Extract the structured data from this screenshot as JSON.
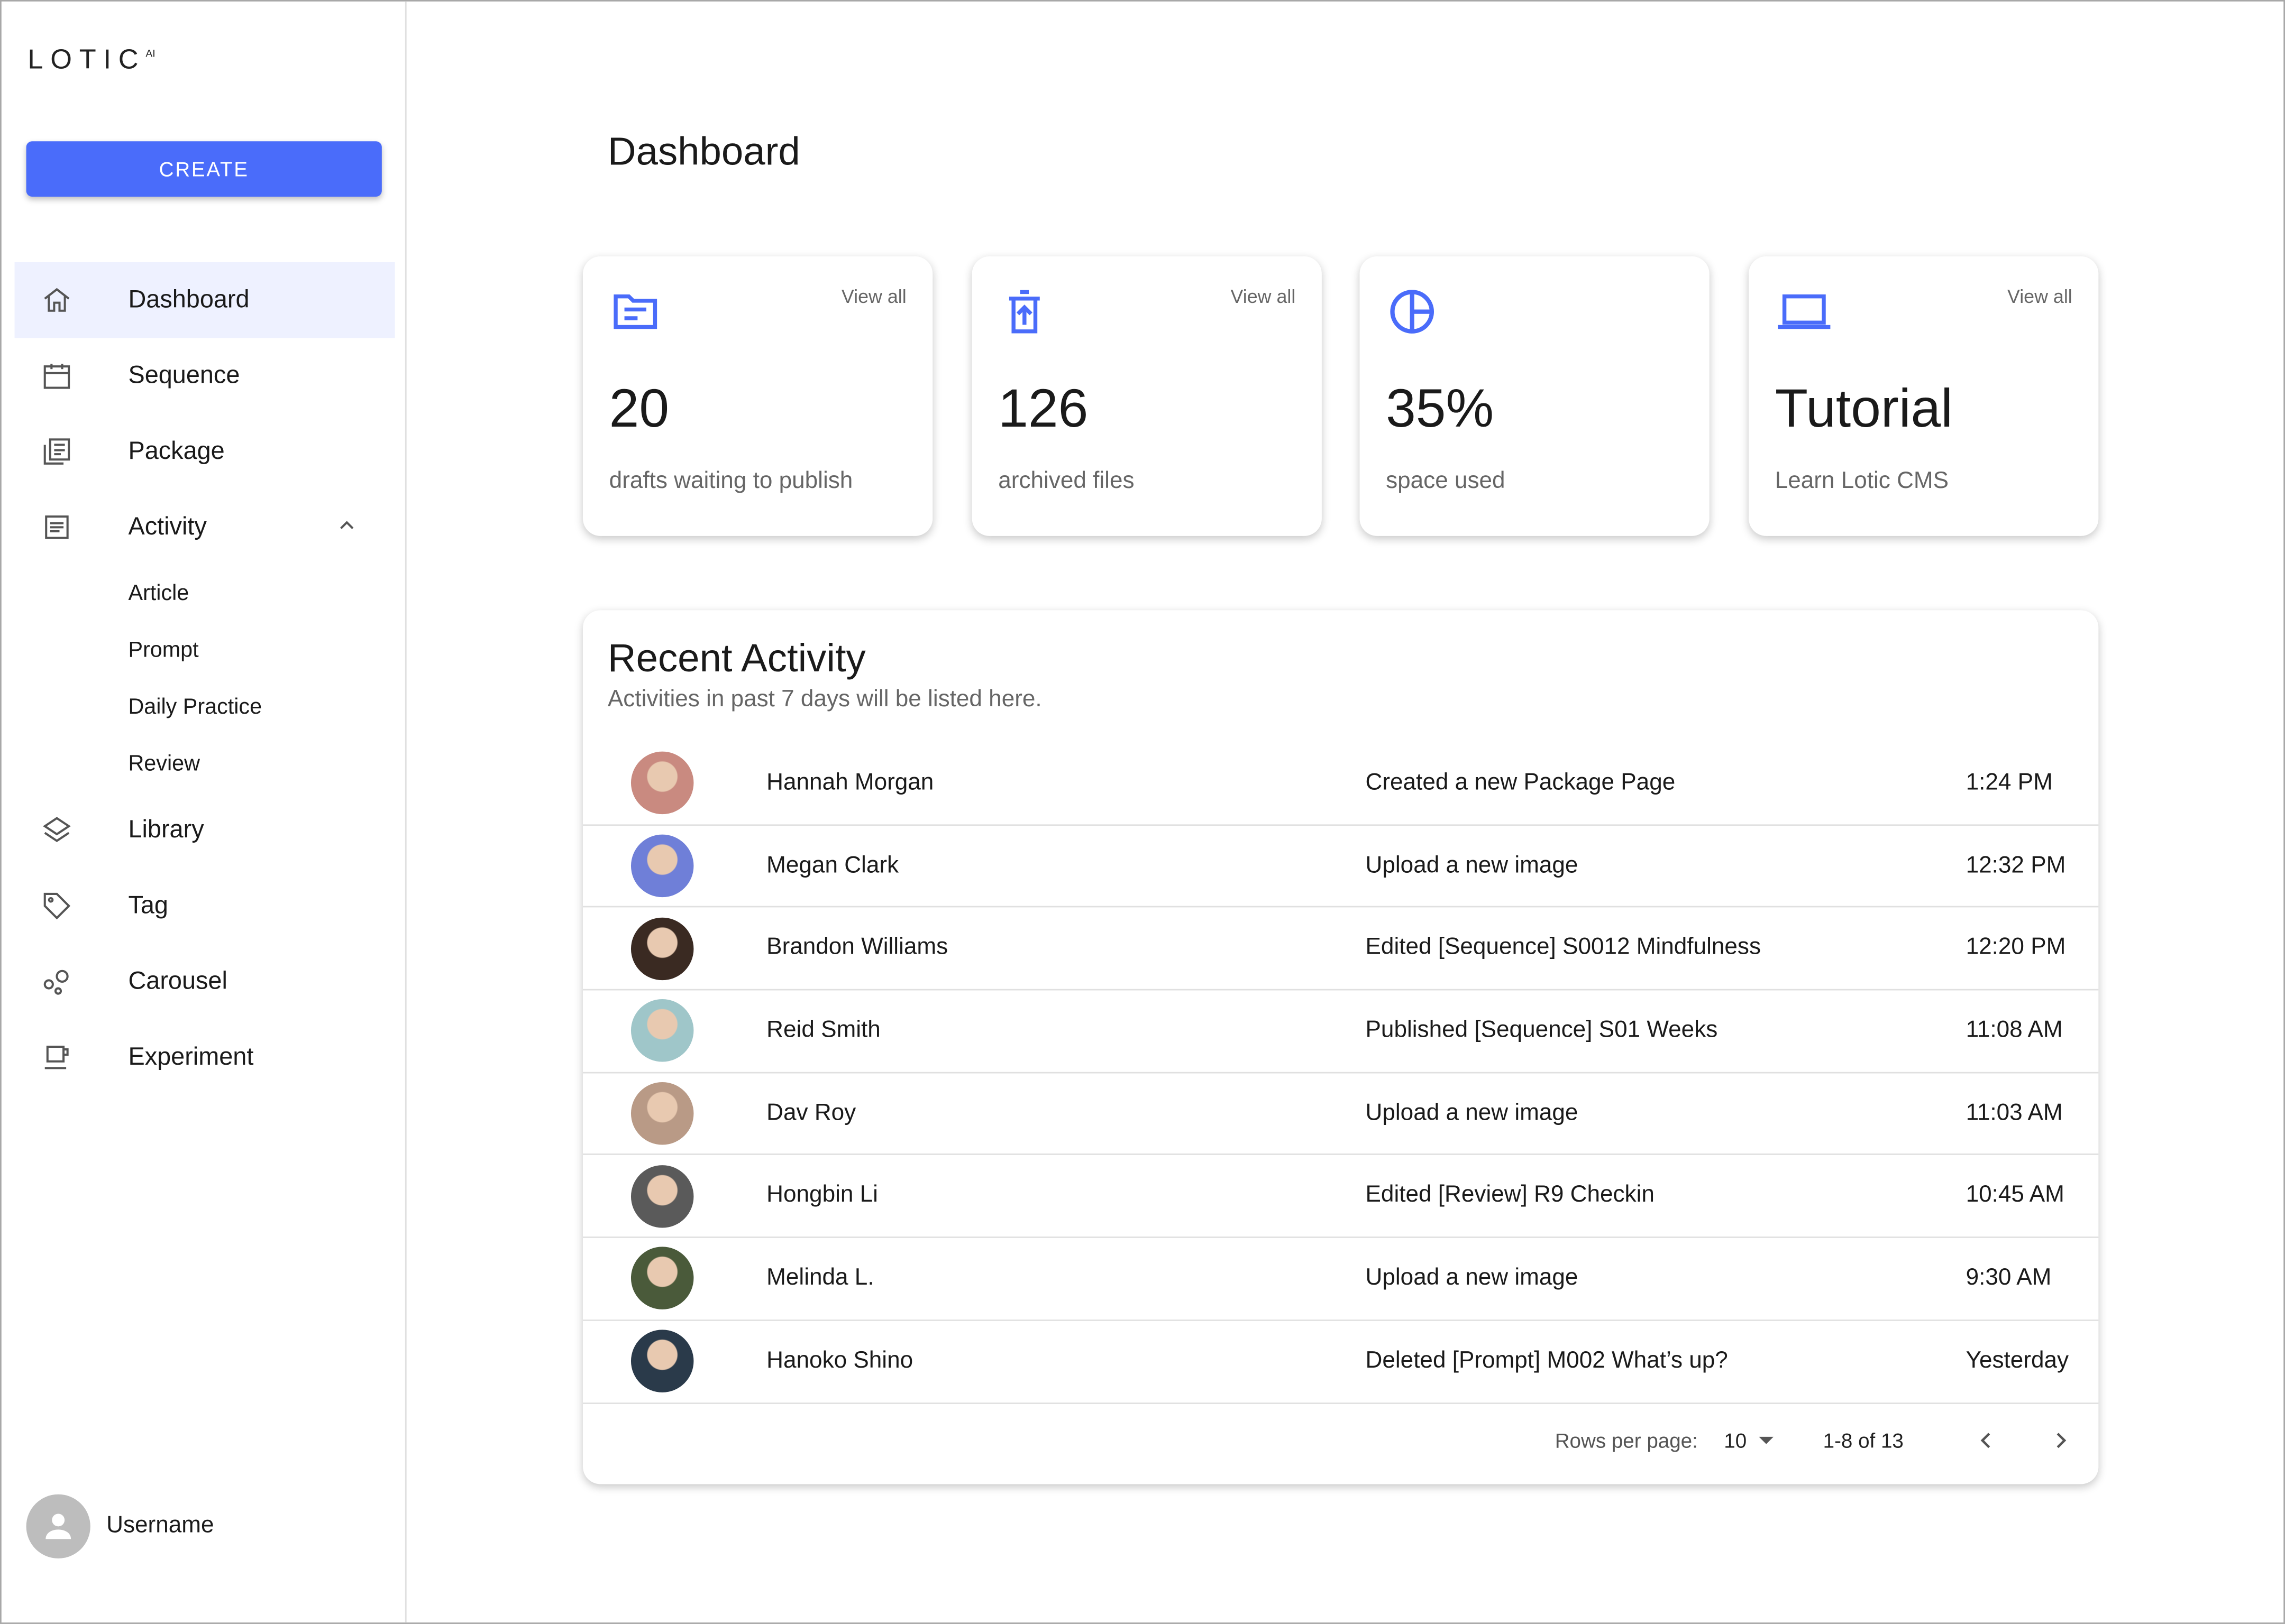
{
  "brand": {
    "logo_text": "LOTIC",
    "logo_sup": "AI",
    "accent": "#4a6cfa"
  },
  "sidebar": {
    "create_label": "CREATE",
    "items": [
      {
        "label": "Dashboard",
        "icon": "home-icon"
      },
      {
        "label": "Sequence",
        "icon": "calendar-icon"
      },
      {
        "label": "Package",
        "icon": "package-icon"
      },
      {
        "label": "Activity",
        "icon": "article-icon"
      }
    ],
    "activity_sub": [
      "Article",
      "Prompt",
      "Daily Practice",
      "Review"
    ],
    "items2": [
      {
        "label": "Library",
        "icon": "layers-icon"
      },
      {
        "label": "Tag",
        "icon": "tag-icon"
      },
      {
        "label": "Carousel",
        "icon": "bubbles-icon"
      },
      {
        "label": "Experiment",
        "icon": "cup-icon"
      }
    ],
    "username": "Username"
  },
  "header": {
    "title": "Dashboard"
  },
  "cards": [
    {
      "value": "20",
      "label": "drafts waiting to publish",
      "link": "View all",
      "icon": "folder-icon"
    },
    {
      "value": "126",
      "label": "archived files",
      "link": "View all",
      "icon": "archive-icon"
    },
    {
      "value": "35%",
      "label": "space used",
      "icon": "pie-chart-icon"
    },
    {
      "value": "Tutorial",
      "label": "Learn Lotic CMS",
      "link": "View all",
      "icon": "laptop-icon"
    }
  ],
  "recent": {
    "title": "Recent Activity",
    "description": "Activities in past 7 days will be listed here.",
    "rows": [
      {
        "name": "Hannah Morgan",
        "action": "Created a new Package Page",
        "time": "1:24 PM",
        "color": "#c98a80"
      },
      {
        "name": "Megan Clark",
        "action": "Upload a new image",
        "time": "12:32 PM",
        "color": "#6f7fd8"
      },
      {
        "name": "Brandon Williams",
        "action": "Edited [Sequence] S0012 Mindfulness",
        "time": "12:20 PM",
        "color": "#3a2a22"
      },
      {
        "name": "Reid Smith",
        "action": "Published [Sequence] S01 Weeks",
        "time": "11:08 AM",
        "color": "#9fc6c9"
      },
      {
        "name": "Dav Roy",
        "action": "Upload a new image",
        "time": "11:03 AM",
        "color": "#b99a86"
      },
      {
        "name": "Hongbin Li",
        "action": "Edited [Review] R9 Checkin",
        "time": "10:45 AM",
        "color": "#5a5a5a"
      },
      {
        "name": "Melinda L.",
        "action": "Upload a new image",
        "time": "9:30 AM",
        "color": "#4a5a3a"
      },
      {
        "name": "Hanoko Shino",
        "action": "Deleted [Prompt] M002 What’s up?",
        "time": "Yesterday",
        "color": "#2a3a4a"
      }
    ],
    "pager": {
      "rows_label": "Rows per page:",
      "rows_value": "10",
      "range": "1-8 of 13"
    }
  }
}
